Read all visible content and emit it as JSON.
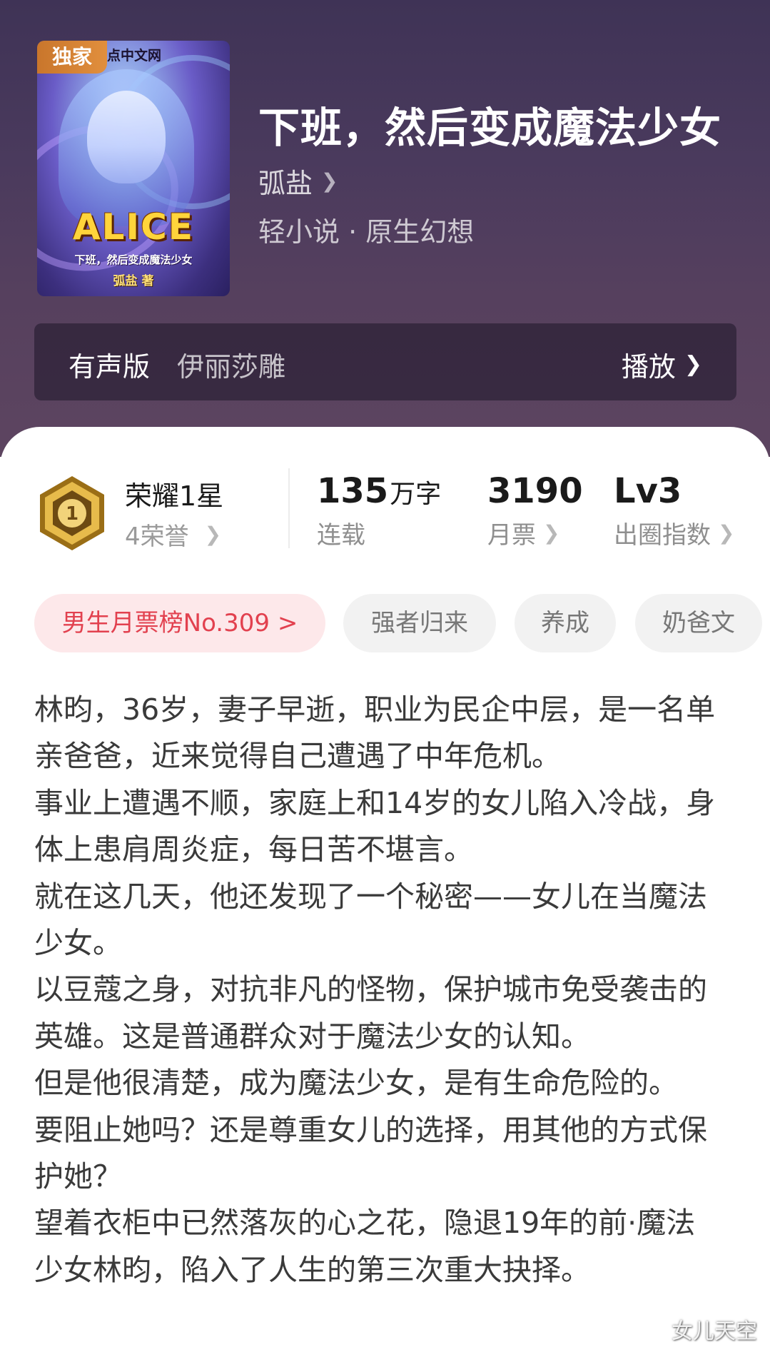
{
  "book": {
    "badge": "独家",
    "cover_site_text": "点中文网",
    "cover_logo": "ALICE",
    "cover_subtitle": "下班，然后变成魔法少女",
    "cover_author": "弧盐 著",
    "title": "下班，然后变成魔法少女",
    "author": "弧盐",
    "genre": "轻小说 · 原生幻想"
  },
  "audio": {
    "label": "有声版",
    "narrator": "伊丽莎雕",
    "play_label": "播放"
  },
  "honor": {
    "title": "荣耀1星",
    "sub": "4荣誉",
    "medal_number": "1"
  },
  "stats": [
    {
      "value": "135",
      "unit": "万字",
      "label": "连载"
    },
    {
      "value": "3190",
      "unit": "",
      "label": "月票"
    },
    {
      "value": "Lv3",
      "unit": "",
      "label": "出圈指数"
    }
  ],
  "tags": {
    "rank": "男生月票榜No.309 >",
    "items": [
      "强者归来",
      "养成",
      "奶爸文"
    ]
  },
  "synopsis": [
    "林昀，36岁，妻子早逝，职业为民企中层，是一名单亲爸爸，近来觉得自己遭遇了中年危机。",
    "事业上遭遇不顺，家庭上和14岁的女儿陷入冷战，身体上患肩周炎症，每日苦不堪言。",
    "就在这几天，他还发现了一个秘密——女儿在当魔法少女。",
    "以豆蔻之身，对抗非凡的怪物，保护城市免受袭击的英雄。这是普通群众对于魔法少女的认知。",
    "但是他很清楚，成为魔法少女，是有生命危险的。",
    "要阻止她吗？还是尊重女儿的选择，用其他的方式保护她？",
    "望着衣柜中已然落灰的心之花，隐退19年的前·魔法少女林昀，陷入了人生的第三次重大抉择。"
  ],
  "watermark": "女儿天空",
  "icons": {
    "chevron": "chevron-right-icon",
    "medal": "medal-icon"
  },
  "colors": {
    "rank_tag_text": "#e2414f",
    "rank_tag_bg": "#fde8ea",
    "medal_gold": "#c99a2e"
  }
}
